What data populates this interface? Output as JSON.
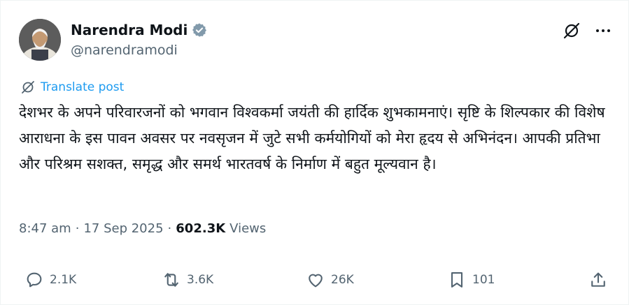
{
  "author": {
    "name": "Narendra Modi",
    "handle": "@narendramodi",
    "verified": true
  },
  "translate_label": "Translate post",
  "post": {
    "text": "देशभर के अपने परिवारजनों को भगवान विश्वकर्मा जयंती की हार्दिक शुभकामनाएं। सृष्टि के शिल्पकार की विशेष आराधना के इस पावन अवसर पर नवसृजन में जुटे सभी कर्मयोगियों को मेरा हृदय से अभिनंदन। आपकी प्रतिभा और परिश्रम सशक्त, समृद्ध और समर्थ भारतवर्ष के निर्माण में बहुत मूल्यवान है।"
  },
  "meta": {
    "time": "8:47 am",
    "separator": "·",
    "date": "17 Sep 2025",
    "views_count": "602.3K",
    "views_label": "Views"
  },
  "actions": {
    "replies": "2.1K",
    "reposts": "3.6K",
    "likes": "26K",
    "bookmarks": "101"
  },
  "icons": {
    "verified": "verified-badge-icon",
    "grok": "grok-icon",
    "more": "more-icon",
    "translate": "translate-icon",
    "reply": "reply-icon",
    "repost": "repost-icon",
    "like": "heart-icon",
    "bookmark": "bookmark-icon",
    "share": "share-icon"
  },
  "colors": {
    "text": "#0f1419",
    "secondary": "#536471",
    "accent": "#1d9bf0",
    "verified": "#829aab"
  }
}
